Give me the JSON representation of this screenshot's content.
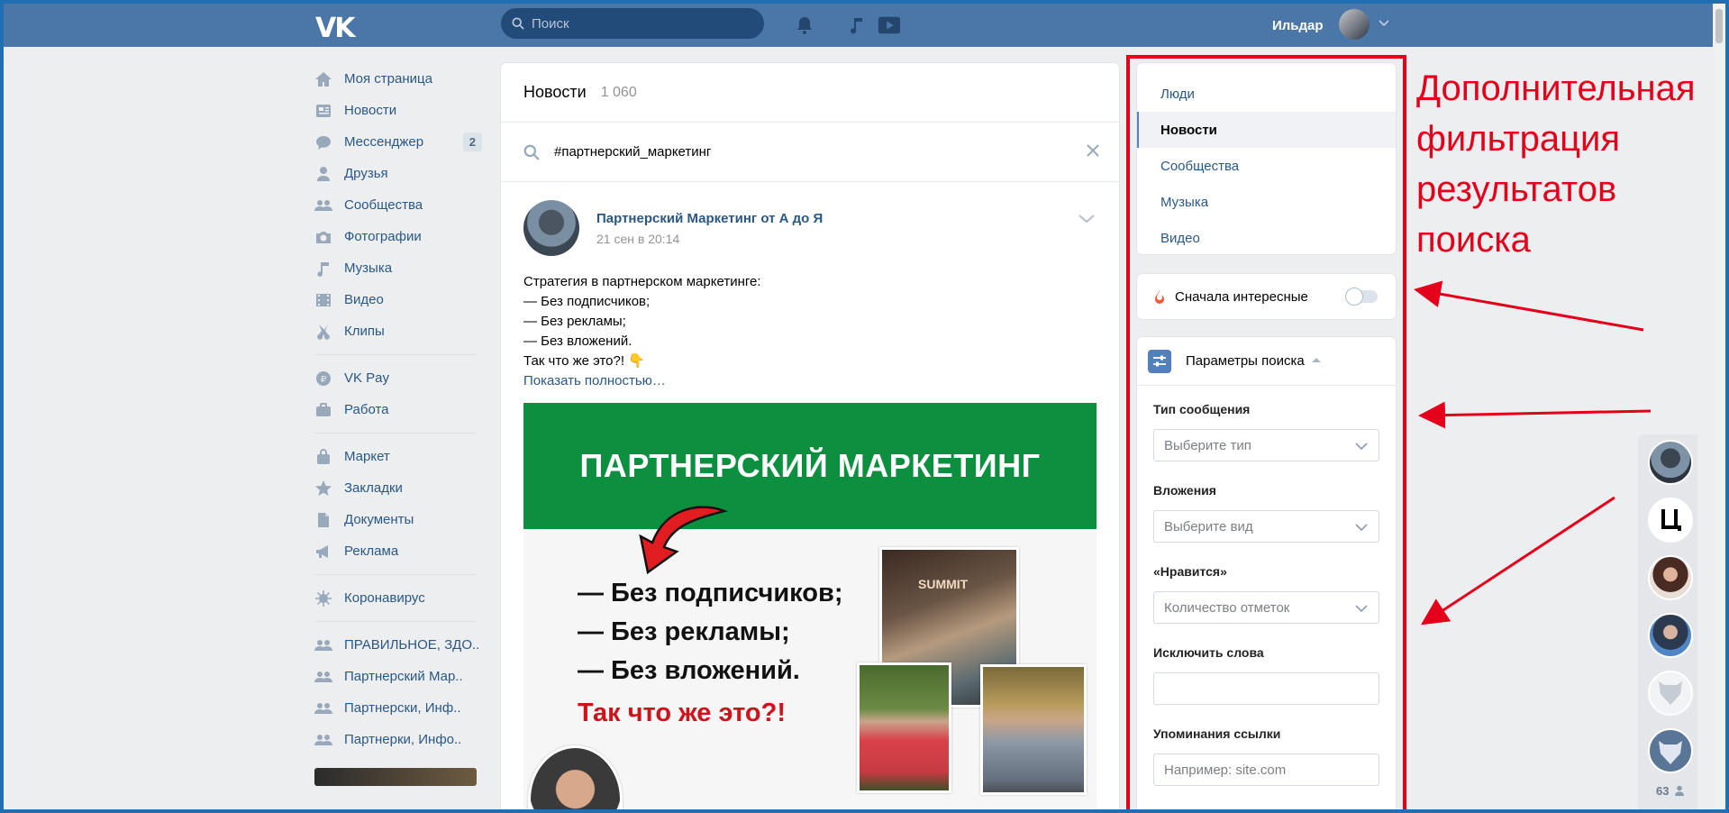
{
  "header": {
    "logo_text": "VK",
    "search_placeholder": "Поиск",
    "user_name": "Ильдар"
  },
  "sidebar": {
    "items": [
      {
        "label": "Моя страница",
        "icon": "home-icon"
      },
      {
        "label": "Новости",
        "icon": "news-icon"
      },
      {
        "label": "Мессенджер",
        "icon": "messenger-icon",
        "badge": "2"
      },
      {
        "label": "Друзья",
        "icon": "friends-icon"
      },
      {
        "label": "Сообщества",
        "icon": "communities-icon"
      },
      {
        "label": "Фотографии",
        "icon": "camera-icon"
      },
      {
        "label": "Музыка",
        "icon": "music-icon"
      },
      {
        "label": "Видео",
        "icon": "video-icon"
      },
      {
        "label": "Клипы",
        "icon": "clips-icon"
      },
      {
        "label": "VK Pay",
        "icon": "vkpay-icon"
      },
      {
        "label": "Работа",
        "icon": "briefcase-icon"
      },
      {
        "label": "Маркет",
        "icon": "bag-icon"
      },
      {
        "label": "Закладки",
        "icon": "star-icon"
      },
      {
        "label": "Документы",
        "icon": "document-icon"
      },
      {
        "label": "Реклама",
        "icon": "megaphone-icon"
      },
      {
        "label": "Коронавирус",
        "icon": "virus-icon"
      },
      {
        "label": "ПРАВИЛЬНОЕ, ЗДО..",
        "icon": "group-icon"
      },
      {
        "label": "Партнерский Мар..",
        "icon": "group-icon"
      },
      {
        "label": "Партнерски, Инф..",
        "icon": "group-icon"
      },
      {
        "label": "Партнерки, Инфо..",
        "icon": "group-icon"
      }
    ]
  },
  "feed": {
    "title": "Новости",
    "count": "1 060",
    "search_query": "#партнерский_маркетинг",
    "post": {
      "author": "Партнерский Маркетинг от А до Я",
      "date": "21 сен в 20:14",
      "lines": [
        "Стратегия в партнерском маркетинге:",
        "— Без подписчиков;",
        "— Без рекламы;",
        "— Без вложений.",
        "Так что же это?! 👇"
      ],
      "show_more": "Показать полностью…",
      "image": {
        "banner": "ПАРТНЕРСКИЙ МАРКЕТИНГ",
        "lines": [
          "— Без подписчиков;",
          "— Без рекламы;",
          "— Без вложений."
        ],
        "question": "Так что же это?!",
        "photo_tag": "SUMMIT"
      }
    }
  },
  "filters": {
    "sections": [
      {
        "label": "Люди",
        "active": false
      },
      {
        "label": "Новости",
        "active": true
      },
      {
        "label": "Сообщества",
        "active": false
      },
      {
        "label": "Музыка",
        "active": false
      },
      {
        "label": "Видео",
        "active": false
      }
    ],
    "interesting_first": "Сначала интересные",
    "interesting_first_on": false,
    "params": {
      "title": "Параметры поиска",
      "type_label": "Тип сообщения",
      "type_value": "Выберите тип",
      "attach_label": "Вложения",
      "attach_value": "Выберите вид",
      "likes_label": "«Нравится»",
      "likes_value": "Количество отметок",
      "exclude_label": "Исключить слова",
      "exclude_value": "",
      "link_label": "Упоминания ссылки",
      "link_placeholder": "Например: site.com"
    }
  },
  "annotation": {
    "text": "Дополнительная фильтрация результатов поиска",
    "color": "#e4001b"
  },
  "contacts": {
    "count": "63"
  },
  "colors": {
    "topbar": "#4a76a8",
    "link": "#2a5885",
    "banner_green": "#0c9040"
  }
}
